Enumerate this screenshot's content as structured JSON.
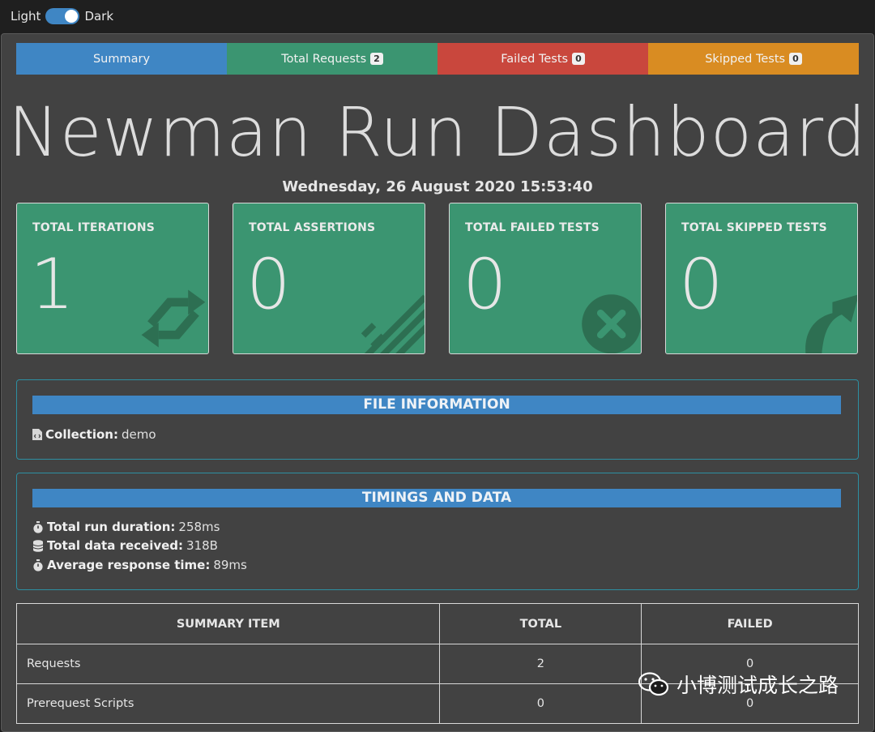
{
  "theme": {
    "light_label": "Light",
    "dark_label": "Dark",
    "mode": "dark"
  },
  "tabs": [
    {
      "label": "Summary",
      "badge": null
    },
    {
      "label": "Total Requests",
      "badge": "2"
    },
    {
      "label": "Failed Tests",
      "badge": "0"
    },
    {
      "label": "Skipped Tests",
      "badge": "0"
    }
  ],
  "title": "Newman Run Dashboard",
  "run_date": "Wednesday, 26 August 2020 15:53:40",
  "cards": [
    {
      "label": "TOTAL ITERATIONS",
      "value": "1",
      "icon": "sync-icon"
    },
    {
      "label": "TOTAL ASSERTIONS",
      "value": "0",
      "icon": "tasks-icon"
    },
    {
      "label": "TOTAL FAILED TESTS",
      "value": "0",
      "icon": "times-circle-icon"
    },
    {
      "label": "TOTAL SKIPPED TESTS",
      "value": "0",
      "icon": "share-arrow-icon"
    }
  ],
  "file_info": {
    "heading": "FILE INFORMATION",
    "collection_label": "Collection:",
    "collection_value": "demo"
  },
  "timings": {
    "heading": "TIMINGS AND DATA",
    "duration_label": "Total run duration:",
    "duration_value": "258ms",
    "data_label": "Total data received:",
    "data_value": "318B",
    "avg_label": "Average response time:",
    "avg_value": "89ms"
  },
  "summary_table": {
    "headers": [
      "SUMMARY ITEM",
      "TOTAL",
      "FAILED"
    ],
    "rows": [
      {
        "item": "Requests",
        "total": "2",
        "failed": "0"
      },
      {
        "item": "Prerequest Scripts",
        "total": "0",
        "failed": "0"
      }
    ]
  },
  "watermark": "小博测试成长之路",
  "colors": {
    "summary": "#3f86c4",
    "success": "#3b9571",
    "danger": "#c9473d",
    "warning": "#d98c22"
  }
}
